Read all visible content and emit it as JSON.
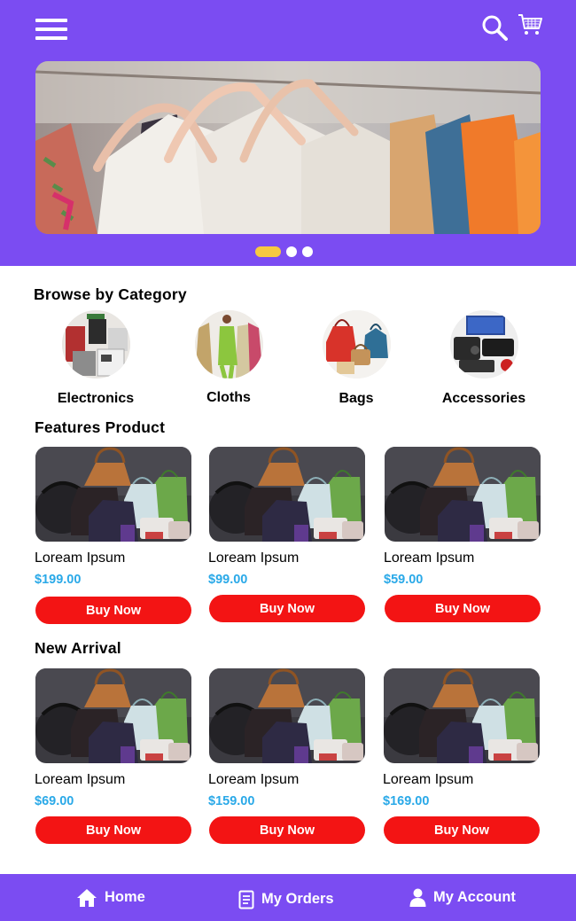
{
  "header": {
    "menu_icon": "hamburger-menu-icon",
    "search_icon": "search-icon",
    "cart_icon": "shopping-cart-icon"
  },
  "banner": {
    "image": "clothing-on-hangers-photo",
    "slides_total": 3,
    "active_slide": 1
  },
  "categories": {
    "title": "Browse by Category",
    "items": [
      {
        "label": "Electronics",
        "image": "electronics-appliances-photo"
      },
      {
        "label": "Cloths",
        "image": "clothing-models-photo"
      },
      {
        "label": "Bags",
        "image": "handbags-photo"
      },
      {
        "label": "Accessories",
        "image": "tech-accessories-photo"
      }
    ]
  },
  "featured": {
    "title": "Features Product",
    "products": [
      {
        "name": "Loream Ipsum",
        "price": "$199.00",
        "button": "Buy Now"
      },
      {
        "name": "Loream Ipsum",
        "price": "$99.00",
        "button": "Buy Now"
      },
      {
        "name": "Loream Ipsum",
        "price": "$59.00",
        "button": "Buy Now"
      }
    ]
  },
  "new_arrival": {
    "title": "New Arrival",
    "products": [
      {
        "name": "Loream Ipsum",
        "price": "$69.00",
        "button": "Buy Now"
      },
      {
        "name": "Loream Ipsum",
        "price": "$159.00",
        "button": "Buy Now"
      },
      {
        "name": "Loream Ipsum",
        "price": "$169.00",
        "button": "Buy Now"
      }
    ]
  },
  "bottom_nav": {
    "items": [
      {
        "label": "Home",
        "icon": "home-icon"
      },
      {
        "label": "My Orders",
        "icon": "orders-icon"
      },
      {
        "label": "My Account",
        "icon": "account-icon"
      }
    ]
  },
  "colors": {
    "brand": "#7b4cf2",
    "button": "#f31414",
    "price": "#2aa9e8",
    "active_dot": "#f7c940"
  }
}
